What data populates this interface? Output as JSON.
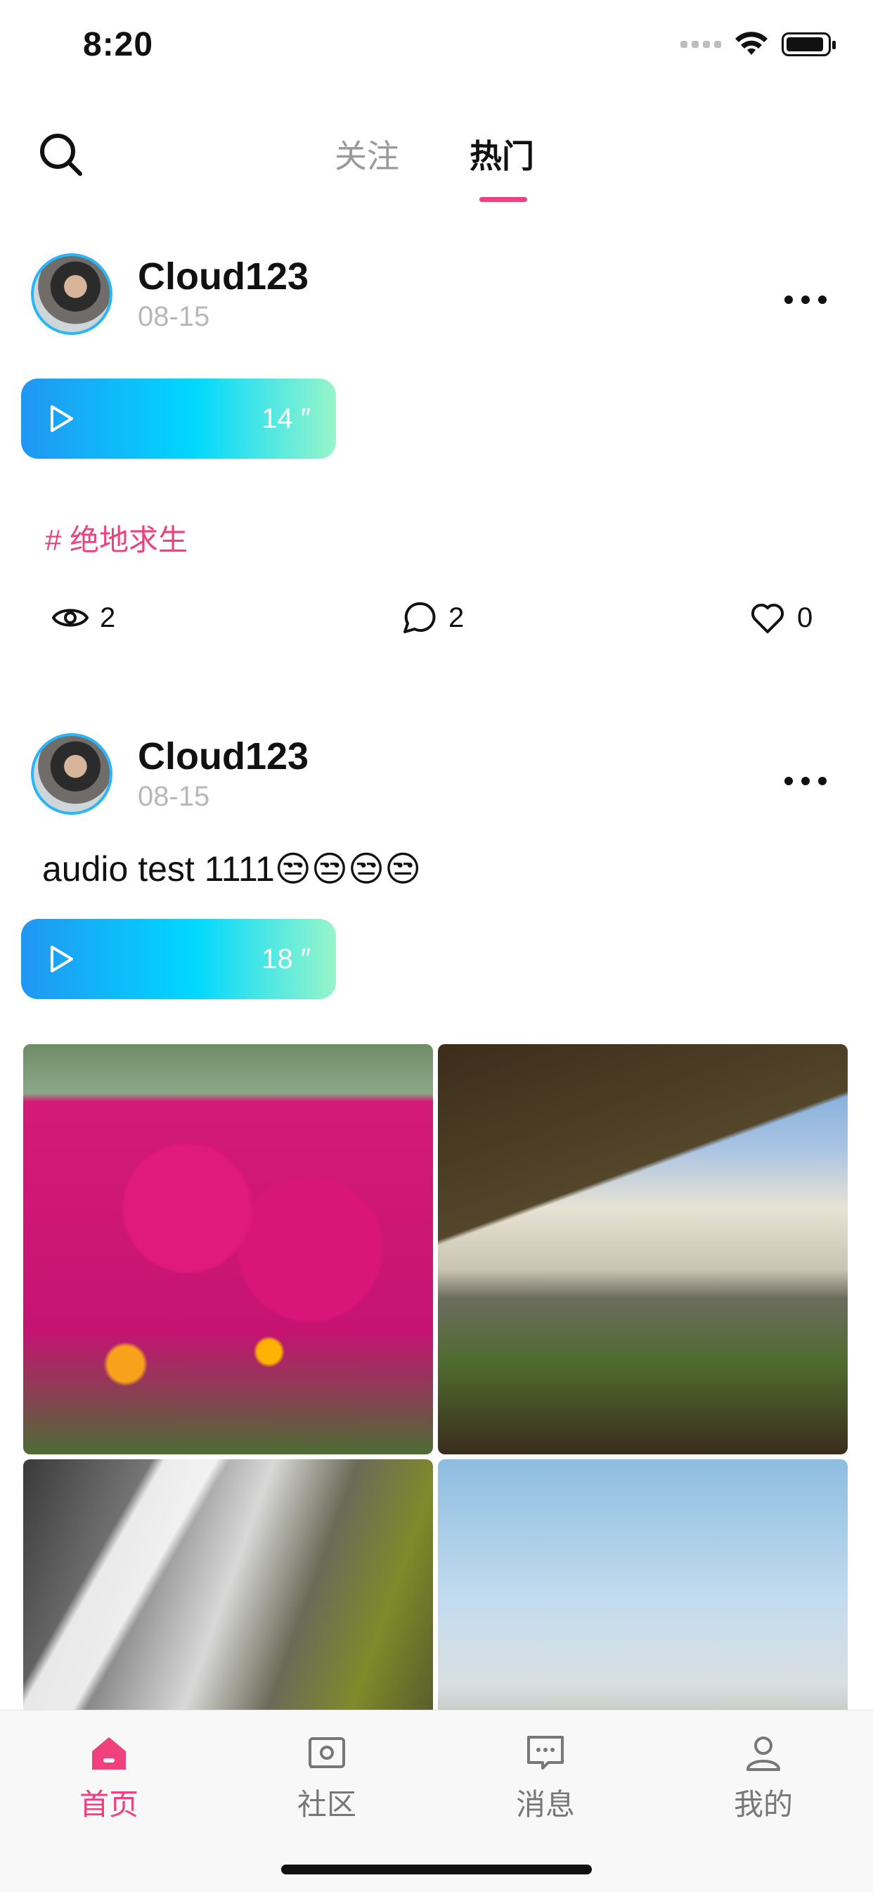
{
  "status_bar": {
    "time": "8:20",
    "icons": [
      "signal-icon",
      "wifi-icon",
      "battery-icon"
    ]
  },
  "header": {
    "tabs": [
      {
        "label": "关注",
        "active": false
      },
      {
        "label": "热门",
        "active": true
      }
    ],
    "accent_color": "#f0407e"
  },
  "posts": [
    {
      "username": "Cloud123",
      "date": "08-15",
      "audio_duration": "14 ″",
      "topic": "# 绝地求生",
      "stats": {
        "views": "2",
        "comments": "2",
        "likes": "0"
      }
    },
    {
      "username": "Cloud123",
      "date": "08-15",
      "text": "audio test 1111😒😒😒😒",
      "audio_duration": "18 ″",
      "images": [
        "flowers-photo",
        "waterfall-photo",
        "stream-photo",
        "grass-photo"
      ]
    }
  ],
  "tabbar": {
    "items": [
      {
        "label": "首页",
        "icon": "home-icon",
        "active": true
      },
      {
        "label": "社区",
        "icon": "community-icon",
        "active": false
      },
      {
        "label": "消息",
        "icon": "message-icon",
        "active": false
      },
      {
        "label": "我的",
        "icon": "profile-icon",
        "active": false
      }
    ],
    "active_color": "#f0407e",
    "inactive_color": "#777777"
  }
}
